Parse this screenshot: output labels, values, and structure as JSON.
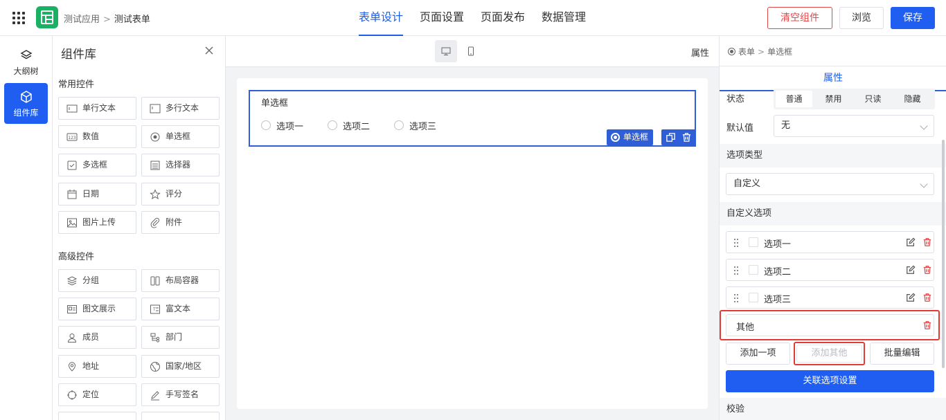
{
  "header": {
    "breadcrumb": [
      "测试应用",
      "测试表单"
    ],
    "breadcrumb_sep": ">",
    "tabs": [
      "表单设计",
      "页面设置",
      "页面发布",
      "数据管理"
    ],
    "active_tab": 0,
    "buttons": {
      "clear": "清空组件",
      "preview": "浏览",
      "save": "保存"
    }
  },
  "rail": [
    {
      "label": "大纲树",
      "icon": "layers-icon"
    },
    {
      "label": "组件库",
      "icon": "cube-icon",
      "active": true
    }
  ],
  "library": {
    "title": "组件库",
    "common_title": "常用控件",
    "common": [
      {
        "label": "单行文本",
        "icon": "single-line-icon"
      },
      {
        "label": "多行文本",
        "icon": "multi-line-icon"
      },
      {
        "label": "数值",
        "icon": "number-icon"
      },
      {
        "label": "单选框",
        "icon": "radio-icon"
      },
      {
        "label": "多选框",
        "icon": "checkbox-icon"
      },
      {
        "label": "选择器",
        "icon": "select-icon"
      },
      {
        "label": "日期",
        "icon": "calendar-icon"
      },
      {
        "label": "评分",
        "icon": "star-icon"
      },
      {
        "label": "图片上传",
        "icon": "image-icon"
      },
      {
        "label": "附件",
        "icon": "paperclip-icon"
      }
    ],
    "advanced_title": "高级控件",
    "advanced": [
      {
        "label": "分组",
        "icon": "group-icon"
      },
      {
        "label": "布局容器",
        "icon": "layout-icon"
      },
      {
        "label": "图文展示",
        "icon": "image-text-icon"
      },
      {
        "label": "富文本",
        "icon": "rich-text-icon"
      },
      {
        "label": "成员",
        "icon": "user-icon"
      },
      {
        "label": "部门",
        "icon": "department-icon"
      },
      {
        "label": "地址",
        "icon": "location-icon"
      },
      {
        "label": "国家/地区",
        "icon": "globe-icon"
      },
      {
        "label": "定位",
        "icon": "target-icon"
      },
      {
        "label": "手写签名",
        "icon": "pen-icon"
      }
    ]
  },
  "canvas": {
    "prop_link": "属性",
    "field": {
      "label": "单选框",
      "options": [
        "选项一",
        "选项二",
        "选项三"
      ],
      "tag": "单选框"
    }
  },
  "props": {
    "breadcrumb": [
      "表单",
      "单选框"
    ],
    "tab": "属性",
    "status_label": "状态",
    "status_options": [
      "普通",
      "禁用",
      "只读",
      "隐藏"
    ],
    "status_active": 0,
    "default_label": "默认值",
    "default_value": "无",
    "option_type_title": "选项类型",
    "option_type_value": "自定义",
    "custom_options_title": "自定义选项",
    "options": [
      "选项一",
      "选项二",
      "选项三"
    ],
    "other_option": "其他",
    "buttons": {
      "add_one": "添加一项",
      "add_other": "添加其他",
      "batch_edit": "批量编辑"
    },
    "link_button": "关联选项设置",
    "validation_title": "校验"
  },
  "colors": {
    "primary": "#1f5ef0",
    "danger": "#e04848",
    "logo": "#1ab164"
  }
}
